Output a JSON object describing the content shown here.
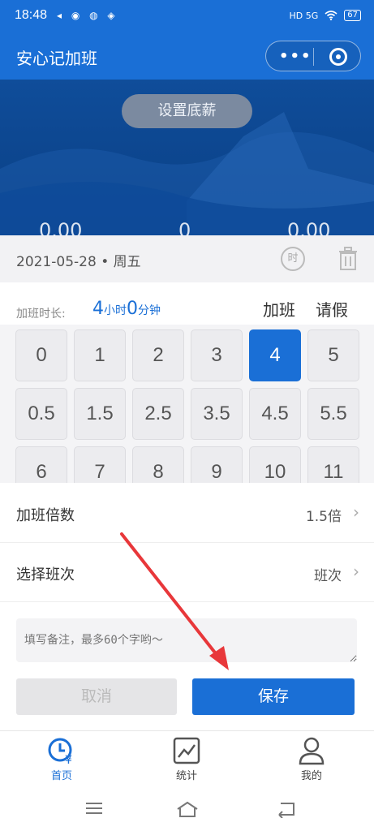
{
  "status_bar": {
    "time": "18:48",
    "notifications": "◂ ◉ ◍ ◈",
    "indicators": "HD 5G",
    "battery": "67"
  },
  "app": {
    "title": "安心记加班",
    "capsule_more": "•••"
  },
  "hero": {
    "set_salary_label": "设置底薪",
    "values": [
      "0.00",
      "0",
      "0.00"
    ]
  },
  "date_row": {
    "date": "2021-05-28 • 周五",
    "clock_glyph": "时"
  },
  "duration": {
    "label": "加班时长:",
    "hours": "4",
    "hours_unit": "小时",
    "minutes": "0",
    "minutes_unit": "分钟",
    "tabs": [
      "加班",
      "请假"
    ]
  },
  "keypad": {
    "keys": [
      "0",
      "1",
      "2",
      "3",
      "4",
      "5",
      "0.5",
      "1.5",
      "2.5",
      "3.5",
      "4.5",
      "5.5",
      "6",
      "7",
      "8",
      "9",
      "10",
      "11"
    ],
    "selected": "4"
  },
  "settings": {
    "multiplier_label": "加班倍数",
    "multiplier_value": "1.5倍",
    "shift_label": "选择班次",
    "shift_value": "班次"
  },
  "remark": {
    "placeholder": "填写备注，最多60个字哟～"
  },
  "actions": {
    "cancel": "取消",
    "save": "保存"
  },
  "tabbar": {
    "items": [
      {
        "label": "首页",
        "icon": "clock-yen-icon"
      },
      {
        "label": "统计",
        "icon": "chart-icon"
      },
      {
        "label": "我的",
        "icon": "person-icon"
      }
    ]
  },
  "colors": {
    "primary": "#1a6fd6",
    "annotation_arrow": "#e8373a"
  }
}
